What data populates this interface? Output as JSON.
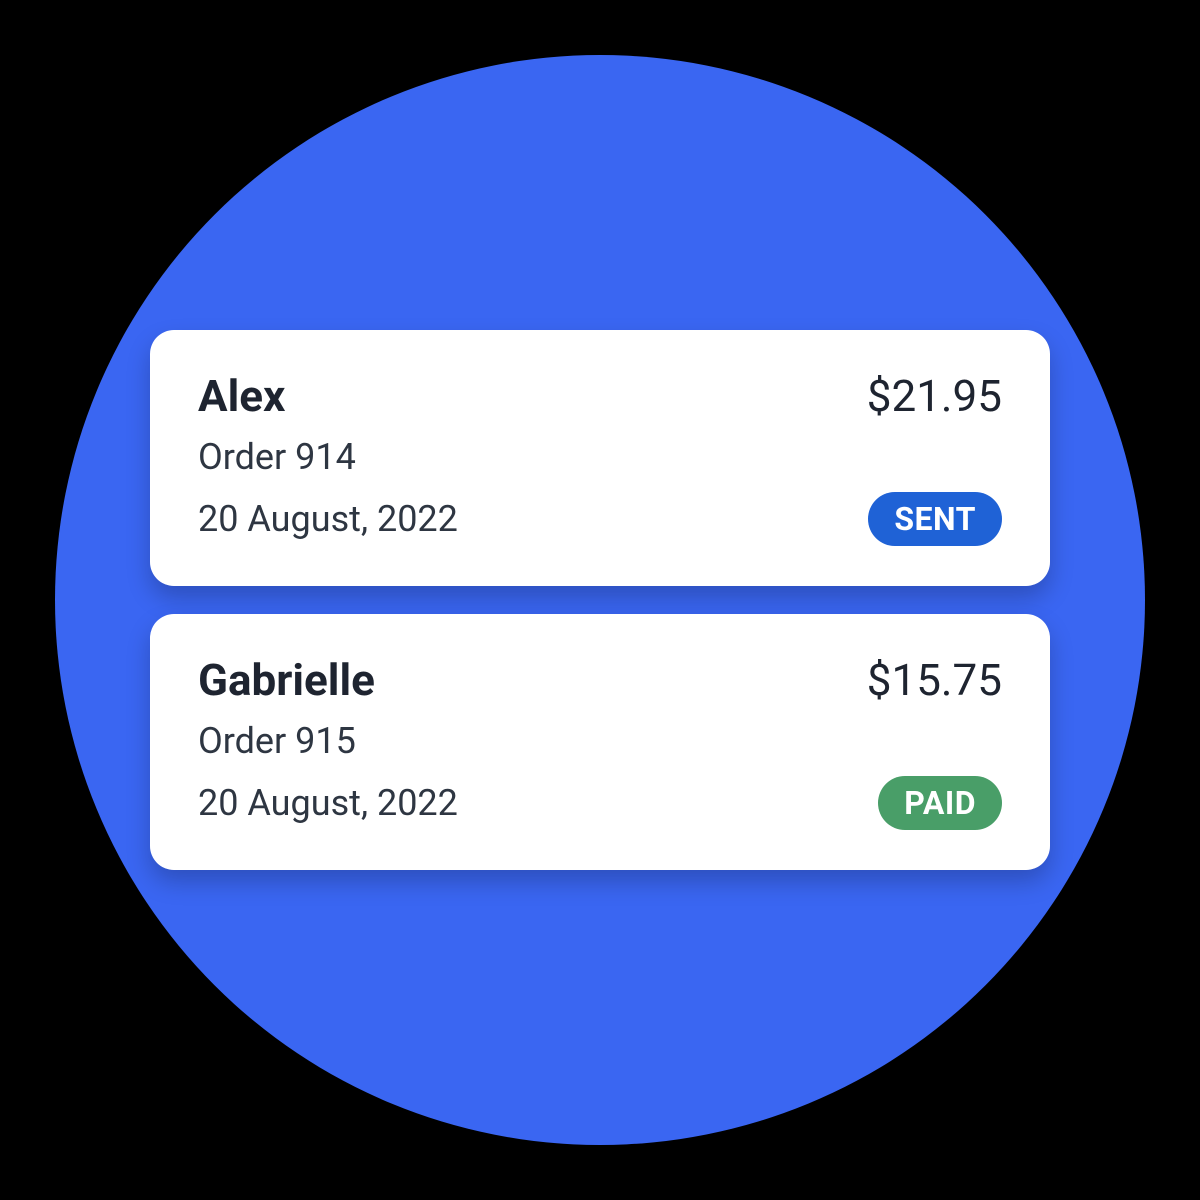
{
  "colors": {
    "circle_bg": "#3A66F2",
    "status_sent": "#1F62D6",
    "status_paid": "#499E68"
  },
  "orders": [
    {
      "name": "Alex",
      "amount": "$21.95",
      "order_label": "Order 914",
      "date": "20 August, 2022",
      "status": "SENT",
      "status_class": "badge-sent"
    },
    {
      "name": "Gabrielle",
      "amount": "$15.75",
      "order_label": "Order 915",
      "date": "20 August, 2022",
      "status": "PAID",
      "status_class": "badge-paid"
    }
  ]
}
